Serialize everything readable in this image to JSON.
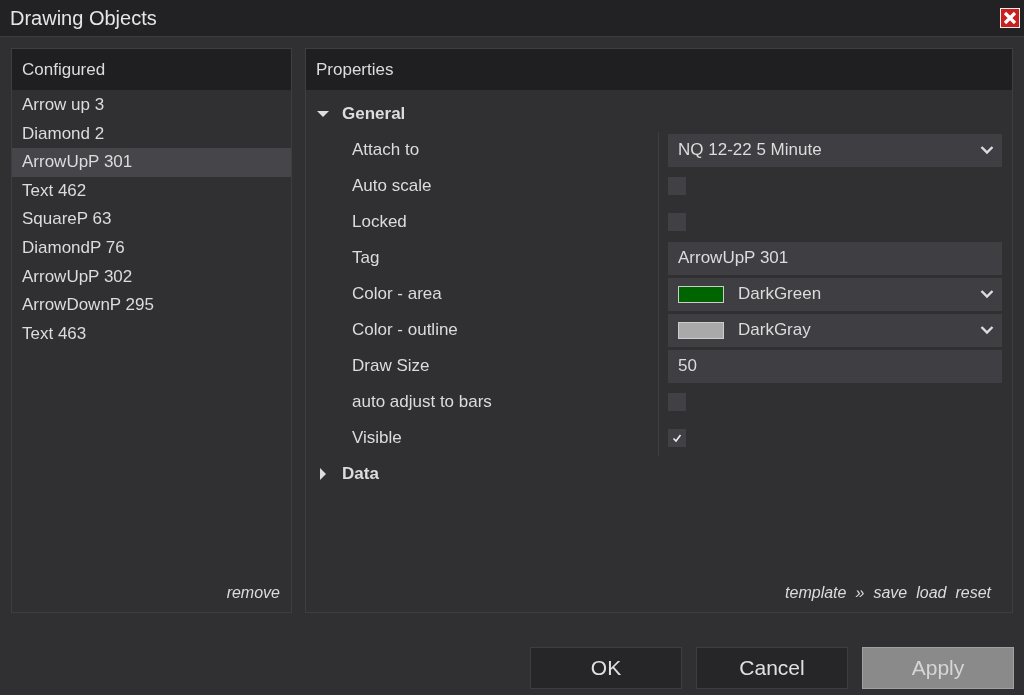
{
  "window": {
    "title": "Drawing Objects"
  },
  "configured": {
    "title": "Configured",
    "items": [
      {
        "label": "Arrow up 3",
        "selected": false
      },
      {
        "label": "Diamond 2",
        "selected": false
      },
      {
        "label": "ArrowUpP 301",
        "selected": true
      },
      {
        "label": "Text 462",
        "selected": false
      },
      {
        "label": "SquareP 63",
        "selected": false
      },
      {
        "label": "DiamondP 76",
        "selected": false
      },
      {
        "label": "ArrowUpP 302",
        "selected": false
      },
      {
        "label": "ArrowDownP 295",
        "selected": false
      },
      {
        "label": "Text 463",
        "selected": false
      }
    ],
    "remove": "remove"
  },
  "properties": {
    "title": "Properties",
    "sections": [
      {
        "label": "General",
        "expanded": true,
        "rows": [
          {
            "label": "Attach to",
            "kind": "dropdown",
            "value": "NQ 12-22 5 Minute"
          },
          {
            "label": "Auto scale",
            "kind": "checkbox",
            "checked": false
          },
          {
            "label": "Locked",
            "kind": "checkbox",
            "checked": false
          },
          {
            "label": "Tag",
            "kind": "text",
            "value": "ArrowUpP 301"
          },
          {
            "label": "Color - area",
            "kind": "color",
            "value": "DarkGreen",
            "color": "#006400"
          },
          {
            "label": "Color - outline",
            "kind": "color",
            "value": "DarkGray",
            "color": "#a9a9a9"
          },
          {
            "label": "Draw Size",
            "kind": "text",
            "value": "50"
          },
          {
            "label": "auto adjust to bars",
            "kind": "checkbox",
            "checked": false
          },
          {
            "label": "Visible",
            "kind": "checkbox",
            "checked": true
          }
        ]
      },
      {
        "label": "Data",
        "expanded": false
      }
    ],
    "footer": {
      "template": "template",
      "separator": "»",
      "links": [
        "save",
        "load",
        "reset"
      ]
    }
  },
  "buttons": [
    {
      "label": "OK",
      "disabled": false
    },
    {
      "label": "Cancel",
      "disabled": false
    },
    {
      "label": "Apply",
      "disabled": true
    }
  ]
}
